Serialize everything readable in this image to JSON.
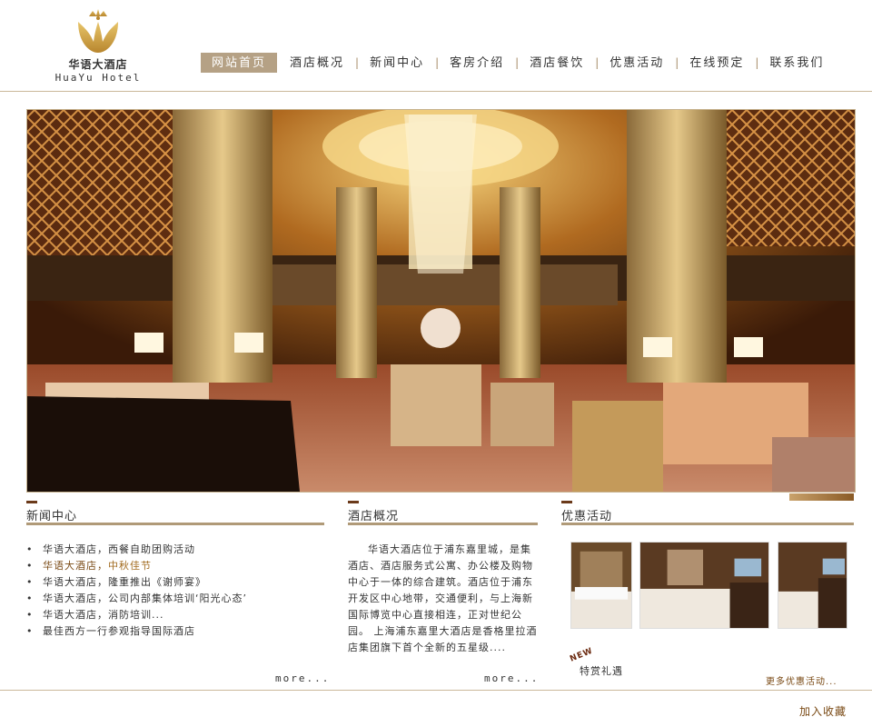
{
  "header": {
    "logo_cn": "华语大酒店",
    "logo_en": "HuaYu Hotel",
    "nav": [
      {
        "label": "网站首页",
        "active": true
      },
      {
        "label": "酒店概况"
      },
      {
        "label": "新闻中心"
      },
      {
        "label": "客房介绍"
      },
      {
        "label": "酒店餐饮"
      },
      {
        "label": "优惠活动"
      },
      {
        "label": "在线预定"
      },
      {
        "label": "联系我们"
      }
    ]
  },
  "news": {
    "title": "新闻中心",
    "items": [
      {
        "text": "华语大酒店，西餐自助团购活动"
      },
      {
        "prefix": "华语大酒店，",
        "accent": "中秋佳节"
      },
      {
        "text": "华语大酒店，隆重推出《谢师宴》"
      },
      {
        "text": "华语大酒店，公司内部集体培训‘阳光心态’"
      },
      {
        "text": "华语大酒店，消防培训..."
      },
      {
        "text": "最佳西方一行参观指导国际酒店"
      }
    ],
    "more": "more..."
  },
  "about": {
    "title": "酒店概况",
    "text": "华语大酒店位于浦东嘉里城，是集酒店、酒店服务式公寓、办公楼及购物中心于一体的综合建筑。酒店位于浦东开发区中心地带，交通便利，与上海新国际博览中心直接相连，正对世纪公园。 上海浦东嘉里大酒店是香格里拉酒店集团旗下首个全新的五星级....",
    "more": "more..."
  },
  "promo": {
    "title": "优惠活动",
    "badge": "NEW",
    "label": "特赏礼遇",
    "more": "更多优惠活动..."
  },
  "footer": {
    "bookmark": "加入收藏"
  },
  "colors": {
    "accent": "#b5a185",
    "rule": "#b09a78",
    "brown": "#7a4a15"
  }
}
